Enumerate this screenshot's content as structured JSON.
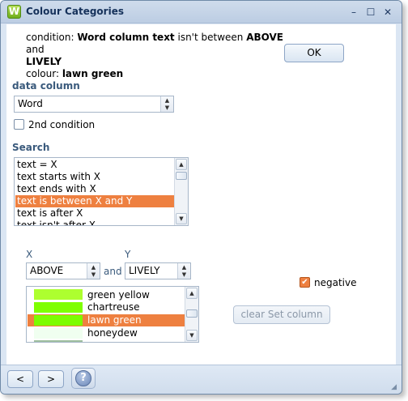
{
  "window": {
    "title": "Colour Categories",
    "app_icon_letter": "W"
  },
  "titlebar": {
    "minimize": "–",
    "maximize": "☐",
    "close": "✕"
  },
  "condition": {
    "prefix": "condition: ",
    "column_text": "Word column text",
    "middle": " isn't between ",
    "above": "ABOVE",
    "and": " and ",
    "lively": "LIVELY",
    "colour_prefix": "colour: ",
    "colour": "lawn green"
  },
  "ok_label": "OK",
  "data_column": {
    "label": "data column",
    "value": "Word"
  },
  "second_condition": {
    "label": "2nd condition",
    "checked": false
  },
  "search": {
    "label": "Search",
    "items": [
      "text = X",
      "text starts with X",
      "text ends with X",
      "text is between X and Y",
      "text is after X",
      "text isn't after X"
    ],
    "selected_index": 3
  },
  "x_field": {
    "label": "X",
    "value": "ABOVE"
  },
  "and_label": "and",
  "y_field": {
    "label": "Y",
    "value": "LIVELY"
  },
  "negative": {
    "label": "negative",
    "checked": true
  },
  "colours": {
    "items": [
      {
        "name": "green yellow",
        "hex": "#adff2f"
      },
      {
        "name": "chartreuse",
        "hex": "#7fff00"
      },
      {
        "name": "lawn green",
        "hex": "#7cfc00"
      },
      {
        "name": "honeydew",
        "hex": "#f0fff0"
      }
    ],
    "selected_index": 2
  },
  "clear_button_label": "clear Set column",
  "nav": {
    "prev": "<",
    "next": ">",
    "help": "?"
  }
}
